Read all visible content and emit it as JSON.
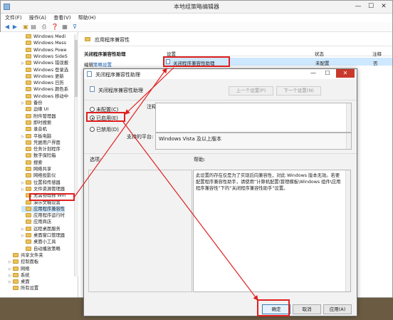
{
  "window": {
    "title": "本地组策略编辑器",
    "minimize": "—",
    "maximize": "☐",
    "close": "✕"
  },
  "menu": [
    "文件(F)",
    "操作(A)",
    "查看(V)",
    "帮助(H)"
  ],
  "toolbar": [
    "◀",
    "▶",
    "▣",
    "▤",
    "⎙",
    "❓",
    "▦",
    "⊽"
  ],
  "tree": {
    "items": [
      {
        "label": "Windows Medi",
        "exp": ""
      },
      {
        "label": "Windows Mess",
        "exp": ""
      },
      {
        "label": "Windows Powe",
        "exp": ""
      },
      {
        "label": "Windows SideS",
        "exp": ""
      },
      {
        "label": "Windows 错误报",
        "exp": "▷"
      },
      {
        "label": "Windows 登录选",
        "exp": ""
      },
      {
        "label": "Windows 更新",
        "exp": ""
      },
      {
        "label": "Windows 日历",
        "exp": ""
      },
      {
        "label": "Windows 颜色系",
        "exp": ""
      },
      {
        "label": "Windows 移动中",
        "exp": ""
      },
      {
        "label": "备份",
        "exp": "▷"
      },
      {
        "label": "边缘 UI",
        "exp": ""
      },
      {
        "label": "附件管理器",
        "exp": ""
      },
      {
        "label": "即时搜索",
        "exp": ""
      },
      {
        "label": "录音机",
        "exp": ""
      },
      {
        "label": "平板电脑",
        "exp": "▷"
      },
      {
        "label": "凭据用户界面",
        "exp": ""
      },
      {
        "label": "任务计划程序",
        "exp": ""
      },
      {
        "label": "数字保险箱",
        "exp": ""
      },
      {
        "label": "搜索",
        "exp": ""
      },
      {
        "label": "网络共享",
        "exp": ""
      },
      {
        "label": "网络投影仪",
        "exp": ""
      },
      {
        "label": "位置和传感器",
        "exp": "▷"
      },
      {
        "label": "文件资源管理器",
        "exp": "▷"
      },
      {
        "label": "无需物理标 Win",
        "exp": ""
      },
      {
        "label": "演示文稿设置",
        "exp": ""
      },
      {
        "label": "应用程序兼容性",
        "exp": ""
      },
      {
        "label": "应用程序运行时",
        "exp": ""
      },
      {
        "label": "应用商店",
        "exp": ""
      },
      {
        "label": "远程桌面服务",
        "exp": "▷"
      },
      {
        "label": "桌面窗口管理器",
        "exp": "▷"
      },
      {
        "label": "桌面小工具",
        "exp": ""
      },
      {
        "label": "自动播放策略",
        "exp": ""
      },
      {
        "label": "共享文件夹",
        "exp": ""
      },
      {
        "label": "控制面板",
        "exp": "▷"
      },
      {
        "label": "网络",
        "exp": "▷"
      },
      {
        "label": "系统",
        "exp": "▷"
      },
      {
        "label": "桌面",
        "exp": "▷"
      },
      {
        "label": "所有设置",
        "exp": ""
      }
    ],
    "selected_index": 26
  },
  "section": {
    "title": "应用程序兼容性"
  },
  "desc": {
    "title": "关闭程序兼容性助理",
    "edit_prefix": "编辑",
    "edit_link": "策略设置"
  },
  "columns": {
    "setting": "设置",
    "state": "状态",
    "note": "注释"
  },
  "setting_row": {
    "label": "关闭程序兼容性助理",
    "state": "未配置",
    "note": "否"
  },
  "dialog": {
    "title": "关闭程序兼容性助理",
    "header_name": "关闭程序兼容性助理",
    "prev": "上一个设置(P)",
    "next": "下一个设置(N)",
    "not_configured": "未配置(C)",
    "enabled": "已启用(E)",
    "disabled": "已禁用(D)",
    "comment_label": "注释:",
    "supported_label": "支持的平台:",
    "supported_value": "Windows Vista 及以上版本",
    "options_label": "选项:",
    "help_label": "帮助:",
    "help_text": "此设置的存在仅是为了实现后向兼容性，对此 Windows 版本无效。若要配置程序兼容性助手，请使用“计算机配置\\管理模板\\Windows 组件\\应用程序兼容性”下的“关闭程序兼容性助手”设置。",
    "ok": "确定",
    "cancel": "取消",
    "apply": "应用(A)",
    "minimize": "—",
    "maximize": "☐",
    "close": "✕",
    "selected_option": "enabled"
  },
  "colors": {
    "highlight": "#e02020",
    "selection": "#cde8ff",
    "close": "#c8392b"
  }
}
